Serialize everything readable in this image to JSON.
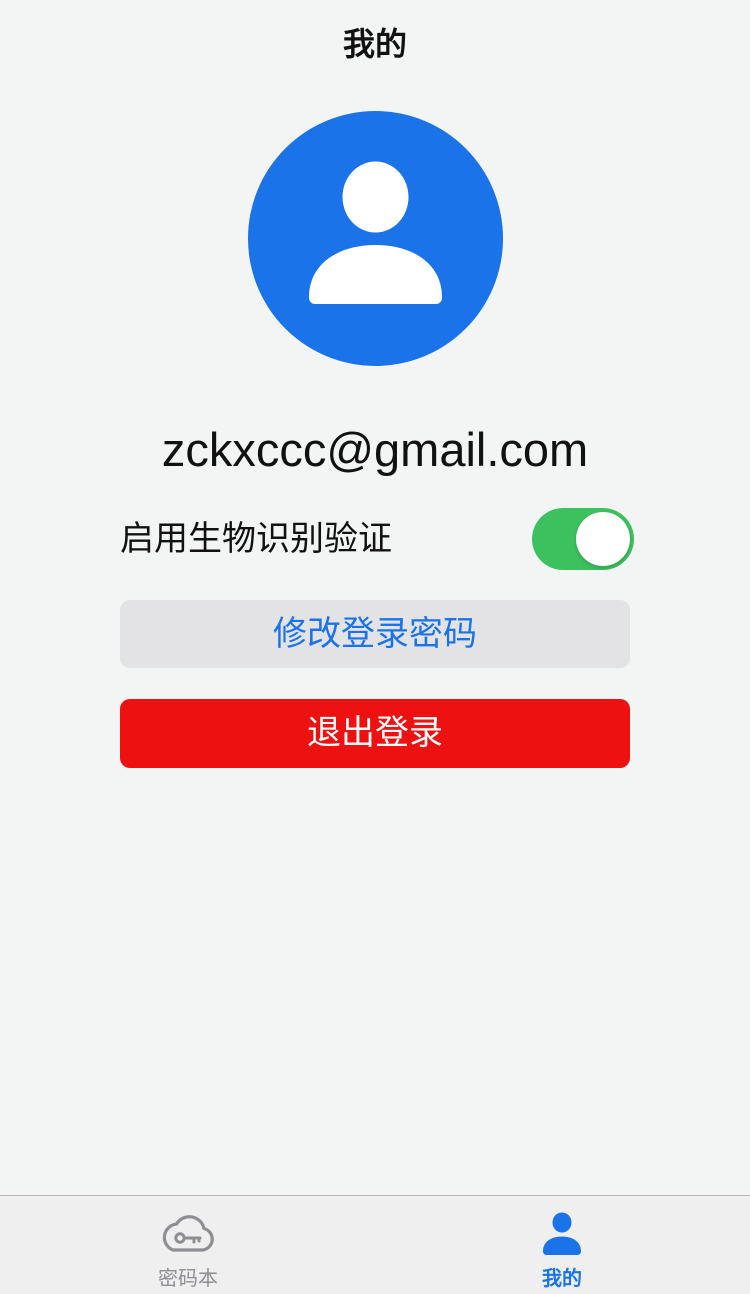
{
  "header": {
    "title": "我的"
  },
  "profile": {
    "avatar_icon": "person-avatar-icon",
    "email": "zckxccc@gmail.com"
  },
  "settings": {
    "biometric_label": "启用生物识别验证",
    "biometric_enabled": true
  },
  "actions": {
    "change_password_label": "修改登录密码",
    "logout_label": "退出登录"
  },
  "tabbar": {
    "items": [
      {
        "label": "密码本",
        "icon": "cloud-key-icon",
        "active": false
      },
      {
        "label": "我的",
        "icon": "person-icon",
        "active": true
      }
    ]
  },
  "colors": {
    "accent": "#1A73E8",
    "background": "#F3F4F4",
    "toggle_on": "#3DC15F",
    "danger": "#EE1111",
    "secondary_button": "#E3E3E6",
    "tab_inactive": "#8E8E93",
    "tab_bar": "#EFEFEF"
  }
}
